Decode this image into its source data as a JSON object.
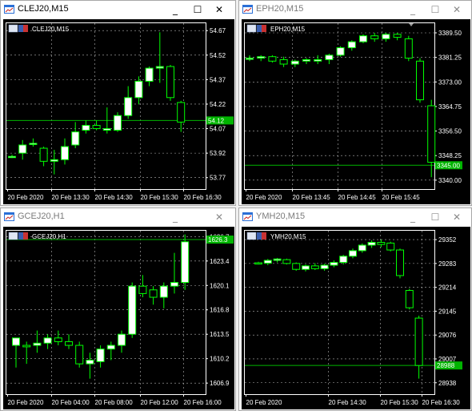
{
  "colors": {
    "background": "#000000",
    "foreground": "#ffffff",
    "grid": "#b4b4b4",
    "bull_candle": "#ffffff",
    "bear_candle": "#000000",
    "candle_outline": "#00ff00",
    "bid_line": "#00b400",
    "price_badge": "#00b400"
  },
  "icons": {
    "window": "chart-window-icon",
    "symbol_flag": "flag-icon"
  },
  "window_buttons": {
    "minimize": "_",
    "maximize": "☐",
    "close": "✕"
  },
  "windows": [
    {
      "title": "CLEJ20,M15",
      "active": true,
      "symbol_label": "CLEJ20,M15",
      "chart_data": {
        "type": "candlestick",
        "y_ticks": [
          "54.67",
          "54.52",
          "54.37",
          "54.22",
          "54.07",
          "53.92",
          "53.77"
        ],
        "ylim": [
          53.7,
          54.72
        ],
        "x_ticks": [
          "20 Feb 2020",
          "20 Feb 13:30",
          "20 Feb 14:30",
          "20 Feb 15:30",
          "20 Feb 16:30"
        ],
        "current_price": "54.12",
        "bid_level": 54.12,
        "candles": [
          {
            "o": 53.9,
            "h": 53.91,
            "l": 53.89,
            "c": 53.9
          },
          {
            "o": 53.92,
            "h": 54.0,
            "l": 53.88,
            "c": 53.97
          },
          {
            "o": 53.98,
            "h": 54.01,
            "l": 53.96,
            "c": 53.98
          },
          {
            "o": 53.95,
            "h": 53.96,
            "l": 53.84,
            "c": 53.87
          },
          {
            "o": 53.87,
            "h": 53.94,
            "l": 53.79,
            "c": 53.88
          },
          {
            "o": 53.88,
            "h": 54.01,
            "l": 53.85,
            "c": 53.96
          },
          {
            "o": 53.97,
            "h": 54.11,
            "l": 53.95,
            "c": 54.05
          },
          {
            "o": 54.06,
            "h": 54.12,
            "l": 54.04,
            "c": 54.09
          },
          {
            "o": 54.09,
            "h": 54.12,
            "l": 54.06,
            "c": 54.07
          },
          {
            "o": 54.06,
            "h": 54.2,
            "l": 54.04,
            "c": 54.07
          },
          {
            "o": 54.06,
            "h": 54.17,
            "l": 54.05,
            "c": 54.15
          },
          {
            "o": 54.15,
            "h": 54.33,
            "l": 54.13,
            "c": 54.26
          },
          {
            "o": 54.26,
            "h": 54.39,
            "l": 54.22,
            "c": 54.36
          },
          {
            "o": 54.36,
            "h": 54.45,
            "l": 54.33,
            "c": 54.44
          },
          {
            "o": 54.44,
            "h": 54.66,
            "l": 54.35,
            "c": 54.45
          },
          {
            "o": 54.45,
            "h": 54.46,
            "l": 54.24,
            "c": 54.26
          },
          {
            "o": 54.23,
            "h": 54.24,
            "l": 54.05,
            "c": 54.11
          }
        ]
      }
    },
    {
      "title": "EPH20,M15",
      "active": false,
      "symbol_label": "EPH20,M15",
      "chart_data": {
        "type": "candlestick",
        "y_ticks": [
          "3389.50",
          "3381.25",
          "3373.00",
          "3364.75",
          "3356.50",
          "3348.25",
          "3340.00"
        ],
        "ylim": [
          3337.0,
          3393.0
        ],
        "x_ticks": [
          "20 Feb 2020",
          "20 Feb 13:45",
          "20 Feb 14:45",
          "20 Feb 15:45"
        ],
        "current_price": "3345.00",
        "bid_level": 3345.0,
        "candles": [
          {
            "o": 3381.0,
            "h": 3382.0,
            "l": 3380.0,
            "c": 3381.0
          },
          {
            "o": 3381.0,
            "h": 3382.0,
            "l": 3380.0,
            "c": 3381.5
          },
          {
            "o": 3381.5,
            "h": 3382.0,
            "l": 3379.5,
            "c": 3380.0
          },
          {
            "o": 3380.5,
            "h": 3381.5,
            "l": 3378.0,
            "c": 3379.0
          },
          {
            "o": 3379.0,
            "h": 3380.5,
            "l": 3378.0,
            "c": 3380.0
          },
          {
            "o": 3380.0,
            "h": 3381.0,
            "l": 3379.0,
            "c": 3380.5
          },
          {
            "o": 3380.0,
            "h": 3382.0,
            "l": 3379.0,
            "c": 3380.5
          },
          {
            "o": 3380.5,
            "h": 3382.5,
            "l": 3379.0,
            "c": 3382.0
          },
          {
            "o": 3382.0,
            "h": 3385.0,
            "l": 3381.5,
            "c": 3384.5
          },
          {
            "o": 3384.5,
            "h": 3387.0,
            "l": 3383.5,
            "c": 3386.5
          },
          {
            "o": 3386.5,
            "h": 3389.0,
            "l": 3386.0,
            "c": 3388.5
          },
          {
            "o": 3388.5,
            "h": 3389.5,
            "l": 3386.5,
            "c": 3387.5
          },
          {
            "o": 3387.5,
            "h": 3389.5,
            "l": 3386.5,
            "c": 3389.0
          },
          {
            "o": 3389.0,
            "h": 3389.5,
            "l": 3387.0,
            "c": 3388.0
          },
          {
            "o": 3387.5,
            "h": 3388.5,
            "l": 3380.0,
            "c": 3381.0
          },
          {
            "o": 3380.0,
            "h": 3381.0,
            "l": 3366.0,
            "c": 3367.0
          },
          {
            "o": 3365.0,
            "h": 3367.0,
            "l": 3341.0,
            "c": 3346.0
          }
        ]
      }
    },
    {
      "title": "GCEJ20,H1",
      "active": false,
      "symbol_label": "GCEJ20,H1",
      "chart_data": {
        "type": "candlestick",
        "y_ticks": [
          "1626.7",
          "1623.4",
          "1620.1",
          "1616.8",
          "1613.5",
          "1610.2",
          "1606.9"
        ],
        "ylim": [
          1605.4,
          1627.6
        ],
        "x_ticks": [
          "20 Feb 2020",
          "20 Feb 04:00",
          "20 Feb 08:00",
          "20 Feb 12:00",
          "20 Feb 16:00"
        ],
        "current_price": "1626.3",
        "bid_level": 1626.3,
        "candles": [
          {
            "o": 1612.0,
            "h": 1613.0,
            "l": 1609.0,
            "c": 1613.0
          },
          {
            "o": 1612.0,
            "h": 1612.5,
            "l": 1609.5,
            "c": 1611.8
          },
          {
            "o": 1612.0,
            "h": 1614.0,
            "l": 1611.0,
            "c": 1612.3
          },
          {
            "o": 1612.3,
            "h": 1613.5,
            "l": 1611.5,
            "c": 1613.0
          },
          {
            "o": 1613.0,
            "h": 1614.0,
            "l": 1612.0,
            "c": 1612.5
          },
          {
            "o": 1612.5,
            "h": 1613.5,
            "l": 1611.5,
            "c": 1612.0
          },
          {
            "o": 1612.0,
            "h": 1612.5,
            "l": 1609.0,
            "c": 1609.5
          },
          {
            "o": 1609.5,
            "h": 1611.0,
            "l": 1607.5,
            "c": 1610.0
          },
          {
            "o": 1609.8,
            "h": 1612.0,
            "l": 1609.0,
            "c": 1611.5
          },
          {
            "o": 1611.5,
            "h": 1612.5,
            "l": 1610.0,
            "c": 1612.0
          },
          {
            "o": 1612.0,
            "h": 1614.0,
            "l": 1611.0,
            "c": 1613.5
          },
          {
            "o": 1613.5,
            "h": 1620.5,
            "l": 1613.0,
            "c": 1620.0
          },
          {
            "o": 1620.0,
            "h": 1621.5,
            "l": 1618.5,
            "c": 1619.0
          },
          {
            "o": 1619.5,
            "h": 1620.0,
            "l": 1617.5,
            "c": 1618.5
          },
          {
            "o": 1618.5,
            "h": 1620.5,
            "l": 1617.0,
            "c": 1620.0
          },
          {
            "o": 1620.0,
            "h": 1624.5,
            "l": 1619.0,
            "c": 1620.5
          },
          {
            "o": 1620.5,
            "h": 1627.0,
            "l": 1619.5,
            "c": 1626.0
          }
        ]
      }
    },
    {
      "title": "YMH20,M15",
      "active": false,
      "symbol_label": "YMH20,M15",
      "chart_data": {
        "type": "candlestick",
        "y_ticks": [
          "29352",
          "29283",
          "29214",
          "29145",
          "29076",
          "29007",
          "28938"
        ],
        "ylim": [
          28905,
          29380
        ],
        "x_ticks": [
          "20 Feb 2020",
          "20 Feb 14:30",
          "20 Feb 15:30",
          "20 Feb 16:30"
        ],
        "current_price": "28988",
        "bid_level": 28988,
        "candles": [
          {
            "o": 29285,
            "h": 29288,
            "l": 29280,
            "c": 29284
          },
          {
            "o": 29284,
            "h": 29296,
            "l": 29278,
            "c": 29292
          },
          {
            "o": 29292,
            "h": 29299,
            "l": 29286,
            "c": 29296
          },
          {
            "o": 29294,
            "h": 29297,
            "l": 29280,
            "c": 29283
          },
          {
            "o": 29283,
            "h": 29286,
            "l": 29262,
            "c": 29266
          },
          {
            "o": 29266,
            "h": 29280,
            "l": 29260,
            "c": 29276
          },
          {
            "o": 29276,
            "h": 29284,
            "l": 29264,
            "c": 29268
          },
          {
            "o": 29268,
            "h": 29282,
            "l": 29262,
            "c": 29278
          },
          {
            "o": 29278,
            "h": 29292,
            "l": 29272,
            "c": 29286
          },
          {
            "o": 29286,
            "h": 29308,
            "l": 29280,
            "c": 29304
          },
          {
            "o": 29304,
            "h": 29326,
            "l": 29298,
            "c": 29320
          },
          {
            "o": 29320,
            "h": 29341,
            "l": 29314,
            "c": 29336
          },
          {
            "o": 29336,
            "h": 29350,
            "l": 29328,
            "c": 29344
          },
          {
            "o": 29344,
            "h": 29352,
            "l": 29330,
            "c": 29338
          },
          {
            "o": 29342,
            "h": 29346,
            "l": 29318,
            "c": 29322
          },
          {
            "o": 29322,
            "h": 29326,
            "l": 29240,
            "c": 29248
          },
          {
            "o": 29205,
            "h": 29210,
            "l": 29150,
            "c": 29155
          },
          {
            "o": 29125,
            "h": 29132,
            "l": 28950,
            "c": 28988
          }
        ]
      }
    }
  ]
}
